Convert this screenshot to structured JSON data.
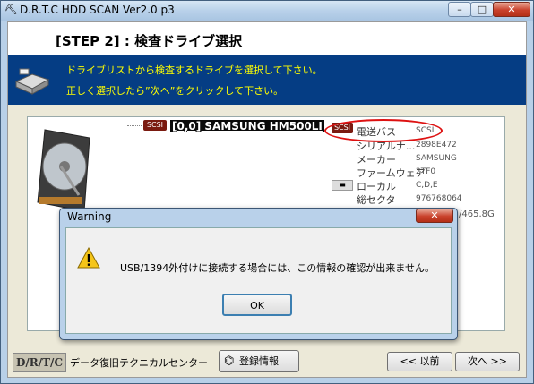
{
  "window": {
    "title": "D.R.T.C HDD SCAN Ver2.0 p3",
    "minimize": "–",
    "maximize": "□",
    "close": "✕"
  },
  "step": {
    "title": "[STEP 2] : 検査ドライブ選択"
  },
  "banner": {
    "line1": "ドライブリストから検査するドライブを選択して下さい。",
    "line2": "正しく選択したら”次へ”をクリックして下さい。"
  },
  "drive": {
    "badge": "SCSI",
    "label": "[0,0] SAMSUNG HM500LI",
    "info_badge": "SCSI",
    "info": [
      {
        "key": "電送バス",
        "value": "SCSI"
      },
      {
        "key": "シリアルナ...",
        "value": "2898E472"
      },
      {
        "key": "メーカー",
        "value": "SAMSUNG"
      },
      {
        "key": "ファームウェア",
        "value": "2TF0"
      },
      {
        "key": "ローカル",
        "value": "C,D,E"
      },
      {
        "key": "総セクタ",
        "value": "976768064"
      }
    ],
    "capacity": "/465.8G"
  },
  "footer": {
    "logo": "D/R/T/C",
    "company": "データ復旧テクニカルセンター",
    "register_label": "登録情報",
    "back_label": "<< 以前",
    "next_label": "次へ >>"
  },
  "dialog": {
    "title": "Warning",
    "close": "✕",
    "message": "USB/1394外付けに接続する場合には、この情報の確認が出来ません。",
    "ok_label": "OK"
  },
  "colors": {
    "banner": "#053d84",
    "banner_text": "#ffff00",
    "highlight_oval": "#dd1111"
  }
}
